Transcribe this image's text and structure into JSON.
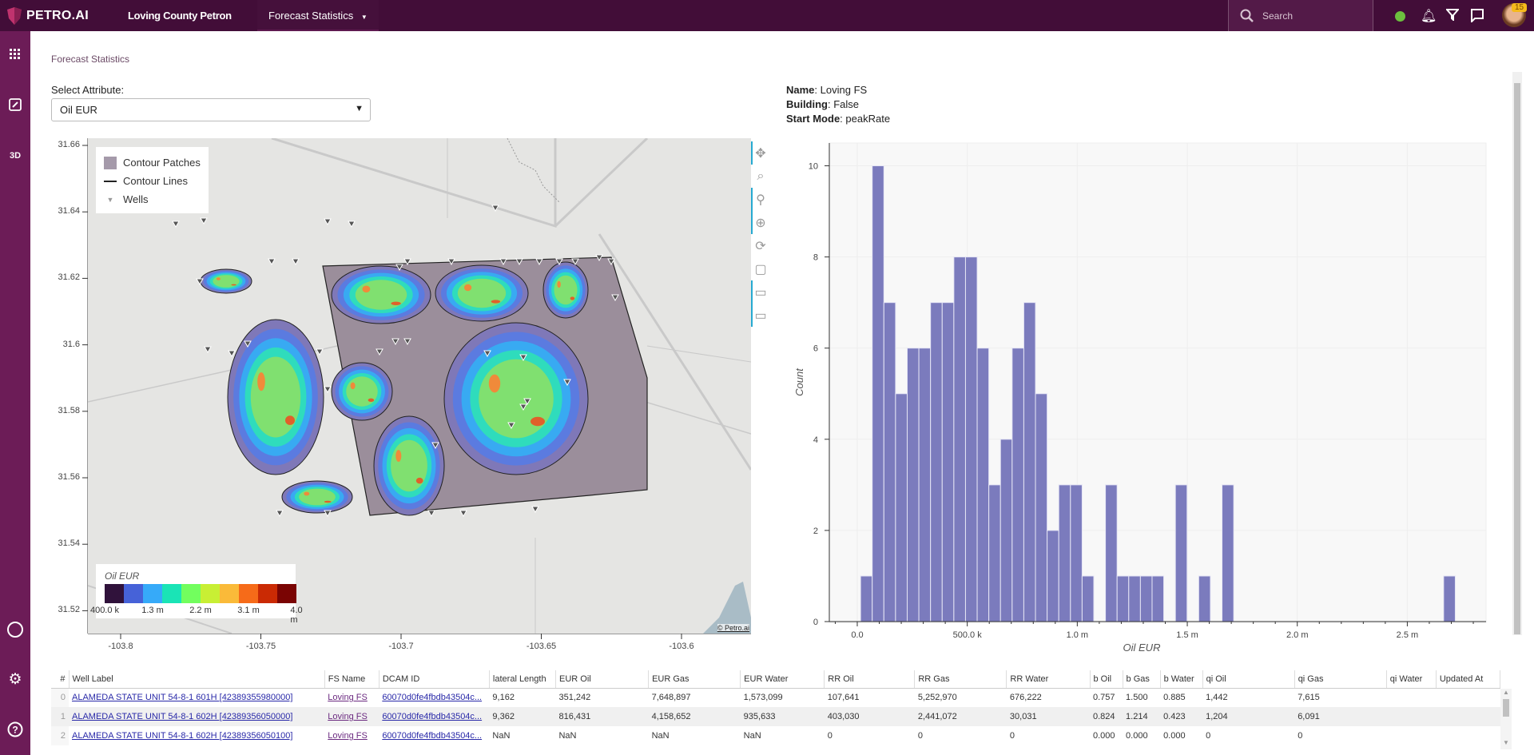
{
  "topbar": {
    "brand": "PETRO.AI",
    "project": "Loving County Petron",
    "nav": "Forecast Statistics",
    "search_placeholder": "Search",
    "notification_count": "15",
    "status_color": "#6cbf3e"
  },
  "sidebar": {
    "items": [
      {
        "icon": "apps-grid-icon"
      },
      {
        "icon": "link-icon"
      },
      {
        "label": "3D"
      },
      {
        "icon": "circle-icon"
      },
      {
        "icon": "gear-icon"
      },
      {
        "icon": "help-icon"
      }
    ]
  },
  "breadcrumb": "Forecast Statistics",
  "attribute": {
    "label": "Select Attribute:",
    "value": "Oil EUR"
  },
  "info": {
    "name_label": "Name",
    "name": "Loving FS",
    "building_label": "Building",
    "building": "False",
    "start_mode_label": "Start Mode",
    "start_mode": "peakRate"
  },
  "map": {
    "x_ticks": [
      {
        "v": -103.8,
        "label": "-103.8"
      },
      {
        "v": -103.75,
        "label": "-103.75"
      },
      {
        "v": -103.7,
        "label": "-103.7"
      },
      {
        "v": -103.65,
        "label": "-103.65"
      },
      {
        "v": -103.6,
        "label": "-103.6"
      }
    ],
    "y_ticks": [
      {
        "v": 31.66,
        "label": "31.66"
      },
      {
        "v": 31.64,
        "label": "31.64"
      },
      {
        "v": 31.62,
        "label": "31.62"
      },
      {
        "v": 31.6,
        "label": "31.6"
      },
      {
        "v": 31.58,
        "label": "31.58"
      },
      {
        "v": 31.56,
        "label": "31.56"
      },
      {
        "v": 31.54,
        "label": "31.54"
      },
      {
        "v": 31.52,
        "label": "31.52"
      }
    ],
    "legend": [
      "Contour Patches",
      "Contour Lines",
      "Wells"
    ],
    "colorbar": {
      "title": "Oil EUR",
      "labels": [
        "400.0 k",
        "1.3 m",
        "2.2 m",
        "3.1 m",
        "4.0 m"
      ],
      "colors": [
        "#30123b",
        "#4662d8",
        "#36aaf9",
        "#1ae4b6",
        "#72fe5e",
        "#c8ef34",
        "#faba39",
        "#f66b19",
        "#ca2a04",
        "#7a0403"
      ]
    },
    "credit": "© Petro.ai"
  },
  "chart_data": {
    "type": "bar",
    "title": "",
    "xlabel": "Oil EUR",
    "ylabel": "Count",
    "bin_start": 15000,
    "bin_width": 53000,
    "counts": [
      1,
      10,
      7,
      5,
      6,
      6,
      7,
      7,
      8,
      8,
      6,
      3,
      4,
      6,
      7,
      5,
      2,
      3,
      3,
      1,
      0,
      3,
      1,
      1,
      1,
      1,
      0,
      3,
      0,
      1,
      0,
      3,
      0,
      0,
      0,
      0,
      0,
      0,
      0,
      0,
      0,
      0,
      0,
      0,
      0,
      0,
      0,
      0,
      0,
      0,
      1
    ],
    "xlim": [
      -127000,
      2858000
    ],
    "ylim": [
      0,
      10.5
    ],
    "x_ticks": [
      {
        "v": 0,
        "label": "0.0"
      },
      {
        "v": 500000,
        "label": "500.0 k"
      },
      {
        "v": 1000000,
        "label": "1.0 m"
      },
      {
        "v": 1500000,
        "label": "1.5 m"
      },
      {
        "v": 2000000,
        "label": "2.0 m"
      },
      {
        "v": 2500000,
        "label": "2.5 m"
      }
    ],
    "y_ticks": [
      {
        "v": 0,
        "label": "0"
      },
      {
        "v": 2,
        "label": "2"
      },
      {
        "v": 4,
        "label": "4"
      },
      {
        "v": 6,
        "label": "6"
      },
      {
        "v": 8,
        "label": "8"
      },
      {
        "v": 10,
        "label": "10"
      }
    ],
    "bar_color": "#7b7bbd",
    "grid": true
  },
  "table": {
    "columns": [
      "#",
      "Well Label",
      "FS Name",
      "DCAM ID",
      "lateral Length",
      "EUR Oil",
      "EUR Gas",
      "EUR Water",
      "RR Oil",
      "RR Gas",
      "RR Water",
      "b Oil",
      "b Gas",
      "b Water",
      "qi Oil",
      "qi Gas",
      "qi Water",
      "Updated At"
    ],
    "rows": [
      [
        "0",
        "ALAMEDA STATE UNIT 54-8-1 601H [42389355980000]",
        "Loving FS",
        "60070d0fe4fbdb43504c...",
        "9,162",
        "351,242",
        "7,648,897",
        "1,573,099",
        "107,641",
        "5,252,970",
        "676,222",
        "0.757",
        "1.500",
        "0.885",
        "1,442",
        "7,615",
        "",
        ""
      ],
      [
        "1",
        "ALAMEDA STATE UNIT 54-8-1 602H [42389356050000]",
        "Loving FS",
        "60070d0fe4fbdb43504c...",
        "9,362",
        "816,431",
        "4,158,652",
        "935,633",
        "403,030",
        "2,441,072",
        "30,031",
        "0.824",
        "1.214",
        "0.423",
        "1,204",
        "6,091",
        "",
        ""
      ],
      [
        "2",
        "ALAMEDA STATE UNIT 54-8-1 602H [42389356050100]",
        "Loving FS",
        "60070d0fe4fbdb43504c...",
        "NaN",
        "NaN",
        "NaN",
        "NaN",
        "0",
        "0",
        "0",
        "0.000",
        "0.000",
        "0.000",
        "0",
        "0",
        "",
        ""
      ]
    ]
  }
}
